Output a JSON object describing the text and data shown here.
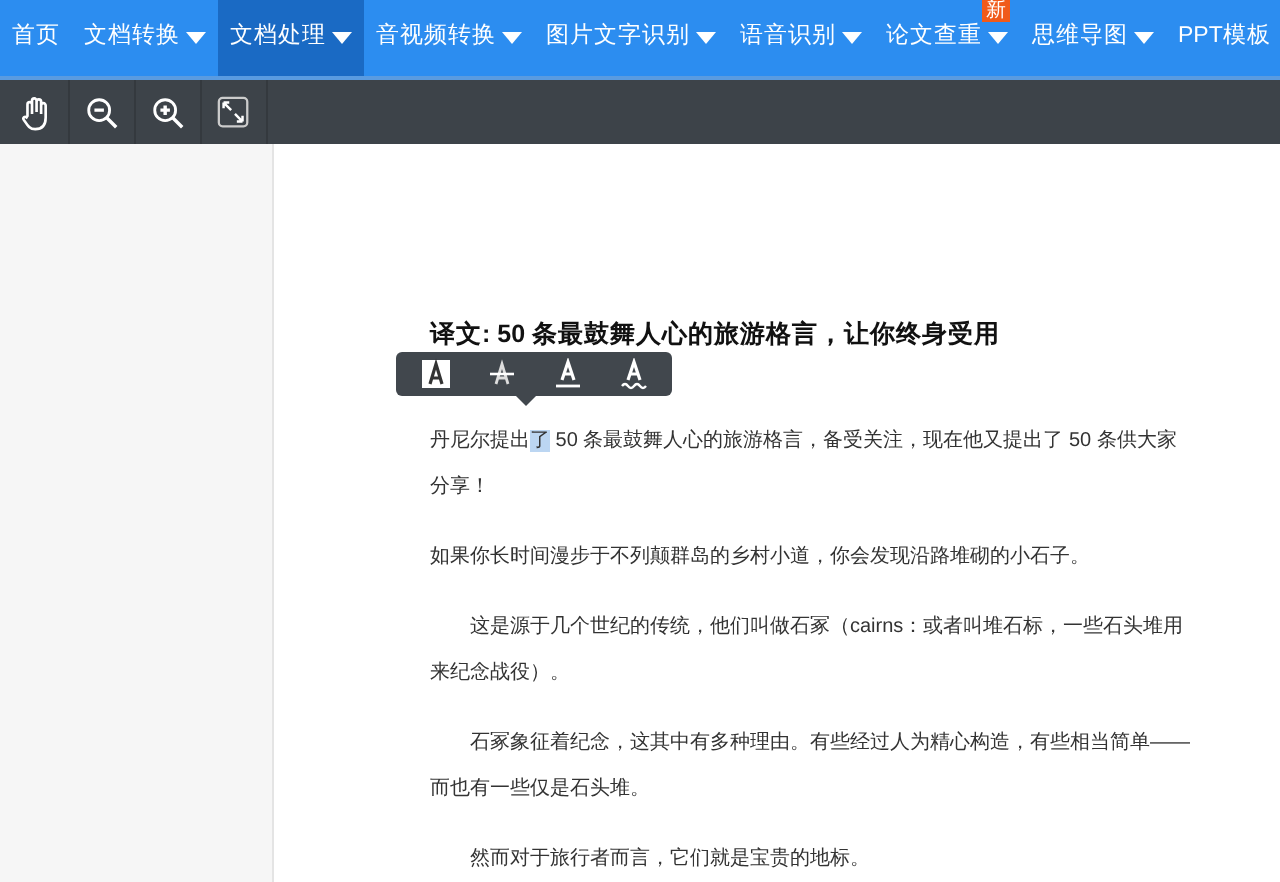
{
  "nav": {
    "items": [
      {
        "label": "首页",
        "selected": false,
        "dropdown": false
      },
      {
        "label": "文档转换",
        "selected": false,
        "dropdown": true
      },
      {
        "label": "文档处理",
        "selected": true,
        "dropdown": true
      },
      {
        "label": "音视频转换",
        "selected": false,
        "dropdown": true
      },
      {
        "label": "图片文字识别",
        "selected": false,
        "dropdown": true
      },
      {
        "label": "语音识别",
        "selected": false,
        "dropdown": true
      },
      {
        "label": "论文查重",
        "selected": false,
        "dropdown": true,
        "badge": "新"
      },
      {
        "label": "思维导图",
        "selected": false,
        "dropdown": true
      },
      {
        "label": "PPT模板",
        "selected": false,
        "dropdown": false
      }
    ]
  },
  "toolbar": {
    "tools": [
      {
        "kind": "hand"
      },
      {
        "kind": "zoom_out"
      },
      {
        "kind": "zoom_in"
      },
      {
        "kind": "fullscreen"
      }
    ]
  },
  "document": {
    "title": "译文: 50 条最鼓舞人心的旅游格言，让你终身受用",
    "format_popup": {
      "buttons": [
        {
          "kind": "highlight"
        },
        {
          "kind": "strikethrough"
        },
        {
          "kind": "underline"
        },
        {
          "kind": "squiggly"
        }
      ]
    },
    "paragraphs": [
      {
        "indent": false,
        "segments": [
          {
            "text": "丹尼尔提出",
            "selected": false
          },
          {
            "text": "了",
            "selected": true
          },
          {
            "text": " 50 条最鼓舞人心的旅游格言，备受关注，现在他又提出了 50 条供大家分享！",
            "selected": false
          }
        ]
      },
      {
        "indent": false,
        "segments": [
          {
            "text": "如果你长时间漫步于不列颠群岛的乡村小道，你会发现沿路堆砌的小石子。",
            "selected": false
          }
        ]
      },
      {
        "indent": true,
        "segments": [
          {
            "text": "这是源于几个世纪的传统，他们叫做石冢（cairns：或者叫堆石标，一些石头堆用来纪念战役）。",
            "selected": false
          }
        ]
      },
      {
        "indent": true,
        "segments": [
          {
            "text": "石冢象征着纪念，这其中有多种理由。有些经过人为精心构造，有些相当简单——而也有一些仅是石头堆。",
            "selected": false
          }
        ]
      },
      {
        "indent": true,
        "segments": [
          {
            "text": "然而对于旅行者而言，它们就是宝贵的地标。",
            "selected": false
          }
        ]
      }
    ]
  }
}
